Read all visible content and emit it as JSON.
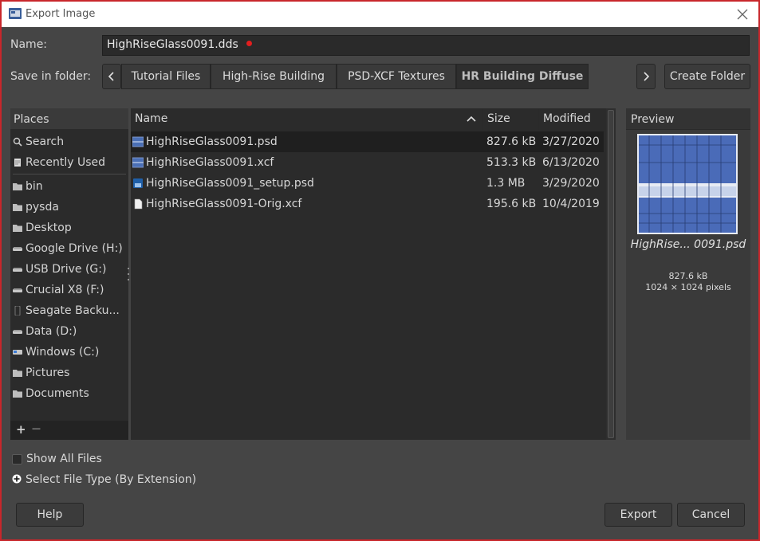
{
  "window": {
    "title": "Export Image"
  },
  "name_field": {
    "label": "Name:",
    "value": "HighRiseGlass0091.dds"
  },
  "folder": {
    "label": "Save in folder:",
    "breadcrumbs": [
      "Tutorial Files",
      "High-Rise Building",
      "PSD-XCF Textures",
      "HR Building Diffuse"
    ],
    "create_folder_label": "Create Folder"
  },
  "places": {
    "header": "Places",
    "items": [
      {
        "label": "Search",
        "icon": "search-icon"
      },
      {
        "label": "Recently Used",
        "icon": "recent-icon"
      },
      {
        "label": "bin",
        "icon": "folder-icon"
      },
      {
        "label": "pysda",
        "icon": "folder-icon"
      },
      {
        "label": "Desktop",
        "icon": "folder-icon"
      },
      {
        "label": "Google Drive (H:)",
        "icon": "drive-icon"
      },
      {
        "label": "USB Drive (G:)",
        "icon": "drive-icon"
      },
      {
        "label": "Crucial X8 (F:)",
        "icon": "drive-icon"
      },
      {
        "label": "Seagate Backu...",
        "icon": "external-drive-icon"
      },
      {
        "label": "Data (D:)",
        "icon": "drive-icon"
      },
      {
        "label": "Windows (C:)",
        "icon": "windows-drive-icon"
      },
      {
        "label": "Pictures",
        "icon": "folder-icon"
      },
      {
        "label": "Documents",
        "icon": "folder-icon"
      }
    ],
    "add_symbol": "+",
    "remove_symbol": "—"
  },
  "files": {
    "columns": {
      "name": "Name",
      "size": "Size",
      "modified": "Modified"
    },
    "rows": [
      {
        "name": "HighRiseGlass0091.psd",
        "size": "827.6 kB",
        "modified": "3/27/2020",
        "icon": "image-file-icon",
        "selected": true
      },
      {
        "name": "HighRiseGlass0091.xcf",
        "size": "513.3 kB",
        "modified": "6/13/2020",
        "icon": "image-file-icon",
        "selected": false
      },
      {
        "name": "HighRiseGlass0091_setup.psd",
        "size": "1.3 MB",
        "modified": "3/29/2020",
        "icon": "photoshop-file-icon",
        "selected": false
      },
      {
        "name": "HighRiseGlass0091-Orig.xcf",
        "size": "195.6 kB",
        "modified": "10/4/2019",
        "icon": "document-file-icon",
        "selected": false
      }
    ]
  },
  "preview": {
    "header": "Preview",
    "filename": "HighRise... 0091.psd",
    "size": "827.6 kB",
    "dimensions": "1024 × 1024 pixels"
  },
  "options": {
    "show_all_files": "Show All Files",
    "select_file_type": "Select File Type (By Extension)"
  },
  "buttons": {
    "help": "Help",
    "export": "Export",
    "cancel": "Cancel"
  },
  "colors": {
    "accent_dot": "#e21e1e",
    "window_bg": "#454545",
    "border": "#c8262b"
  }
}
